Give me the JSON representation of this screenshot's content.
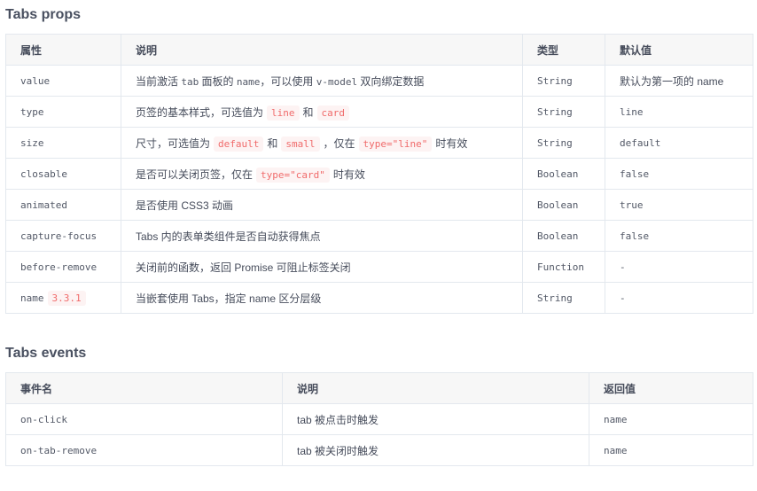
{
  "props": {
    "title": "Tabs props",
    "headers": [
      "属性",
      "说明",
      "类型",
      "默认值"
    ],
    "rows": [
      {
        "name": "value",
        "desc": [
          "当前激活 ",
          "tab",
          " 面板的 ",
          "name",
          "，可以使用 ",
          "v-model",
          " 双向绑定数据"
        ],
        "type": "String",
        "default": "默认为第一项的 name"
      },
      {
        "name": "type",
        "desc_parts": [
          {
            "t": "页签的基本样式，可选值为"
          },
          {
            "c": "line"
          },
          {
            "t": "和"
          },
          {
            "c": "card"
          }
        ],
        "type": "String",
        "default": "line"
      },
      {
        "name": "size",
        "desc_parts": [
          {
            "t": "尺寸，可选值为"
          },
          {
            "c": "default"
          },
          {
            "t": "和"
          },
          {
            "c": "small"
          },
          {
            "t": "，仅在"
          },
          {
            "c": "type=\"line\""
          },
          {
            "t": "时有效"
          }
        ],
        "type": "String",
        "default": "default"
      },
      {
        "name": "closable",
        "desc_parts": [
          {
            "t": "是否可以关闭页签，仅在"
          },
          {
            "c": "type=\"card\""
          },
          {
            "t": "时有效"
          }
        ],
        "type": "Boolean",
        "default": "false"
      },
      {
        "name": "animated",
        "desc_parts": [
          {
            "t": "是否使用 CSS3 动画"
          }
        ],
        "type": "Boolean",
        "default": "true"
      },
      {
        "name": "capture-focus",
        "desc_parts": [
          {
            "t": "Tabs 内的表单类组件是否自动获得焦点"
          }
        ],
        "type": "Boolean",
        "default": "false"
      },
      {
        "name": "before-remove",
        "desc_parts": [
          {
            "t": "关闭前的函数，返回 Promise 可阻止标签关闭"
          }
        ],
        "type": "Function",
        "default": "-"
      },
      {
        "name": "name",
        "version": "3.3.1",
        "desc_parts": [
          {
            "t": "当嵌套使用 Tabs，指定 name 区分层级"
          }
        ],
        "type": "String",
        "default": "-"
      }
    ]
  },
  "events": {
    "title": "Tabs events",
    "headers": [
      "事件名",
      "说明",
      "返回值"
    ],
    "rows": [
      {
        "name": "on-click",
        "desc": "tab 被点击时触发",
        "ret": "name"
      },
      {
        "name": "on-tab-remove",
        "desc": "tab 被关闭时触发",
        "ret": "name"
      }
    ]
  }
}
